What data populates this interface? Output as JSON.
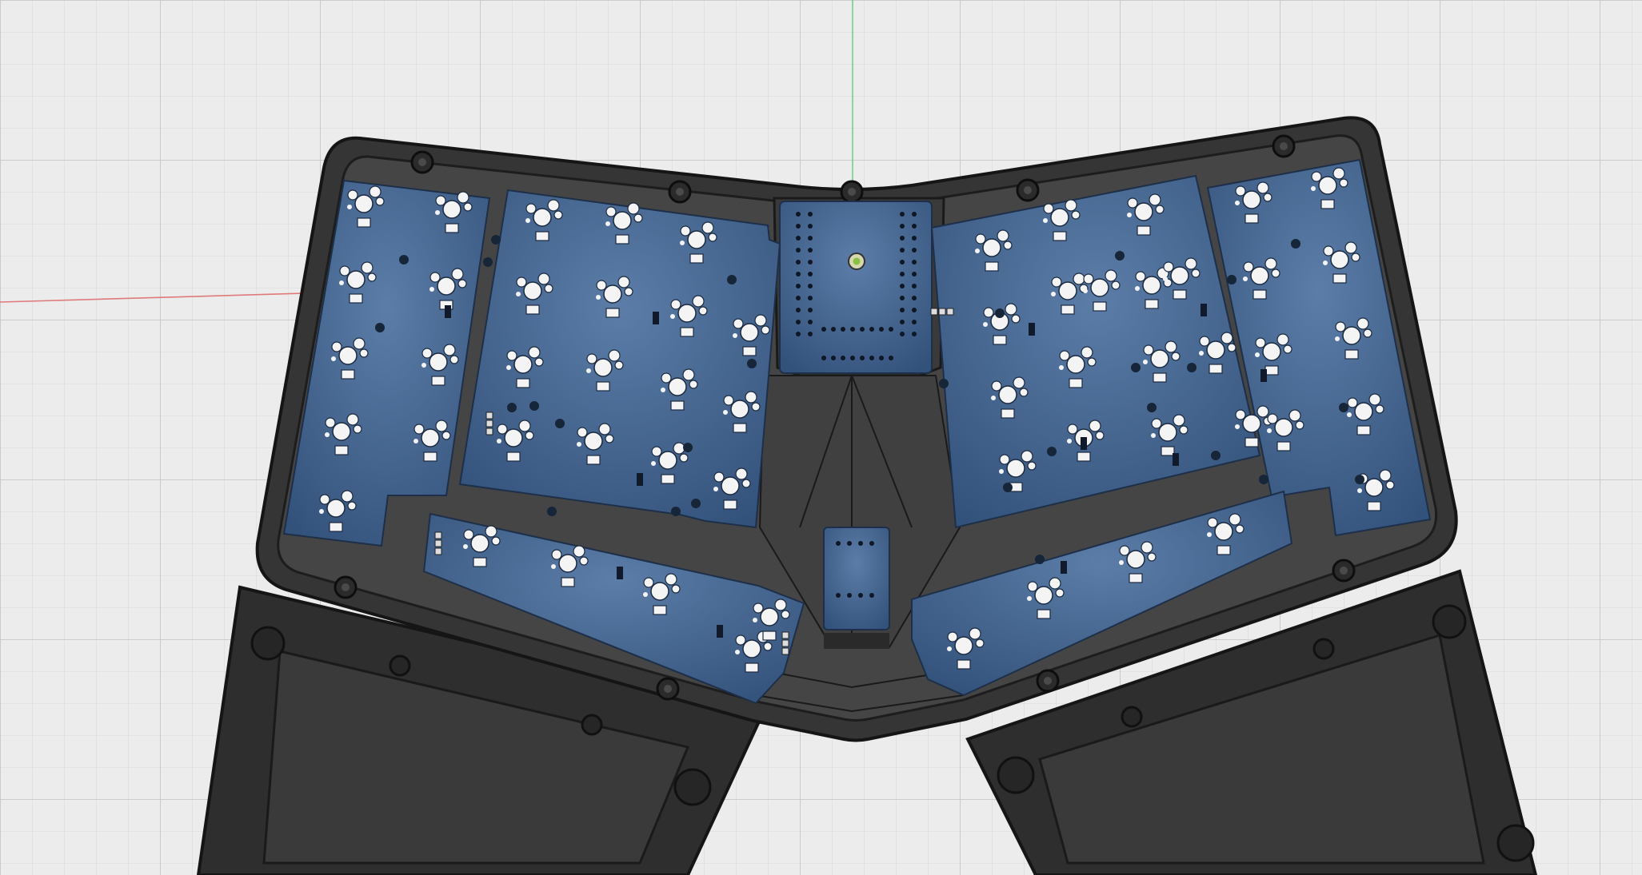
{
  "viewport": {
    "kind": "3d-cad-viewport",
    "background": "#ececec",
    "grid_minor_color": "#d7d7d7",
    "grid_major_color": "#c2c2c2",
    "axis_x_color": "#e07a7a",
    "axis_y_color": "#6fcf8f"
  },
  "model": {
    "case_color": "#353535",
    "case_edge_color": "#151515",
    "case_inner_color": "#454545",
    "wrist_rest_color": "#2e2e2e",
    "pcb_color": "#3d5f8c",
    "pcb_edge_color": "#1d2f49",
    "switch_hole_color": "#f4f4f4",
    "left_main_keys": 30,
    "right_main_keys": 30,
    "left_thumb_keys": 6,
    "right_thumb_keys": 6
  }
}
